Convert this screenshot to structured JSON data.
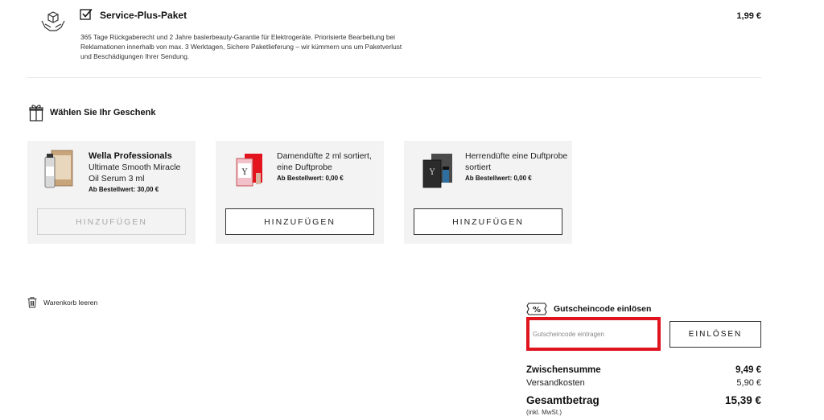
{
  "service_plus": {
    "title": "Service-Plus-Paket",
    "price": "1,99 €",
    "description": "365 Tage Rückgaberecht und 2 Jahre baslerbeauty-Garantie für Elektrogeräte. Priorisierte Bearbeitung bei Reklamationen innerhalb von max. 3 Werktagen, Sichere Paketlieferung – wir kümmern uns um Paketverlust und Beschädigungen Ihrer Sendung.",
    "icon": "box-hands-icon",
    "checked": true
  },
  "gifts": {
    "title": "Wählen Sie Ihr Geschenk",
    "icon": "gift-icon",
    "items": [
      {
        "brand": "Wella Professionals",
        "name": "Ultimate Smooth Miracle Oil Serum 3 ml",
        "min_order": "Ab Bestellwert: 30,00 €",
        "button": "HINZUFÜGEN",
        "disabled": true
      },
      {
        "brand": "",
        "name": "Damendüfte 2 ml sortiert, eine Duftprobe",
        "min_order": "Ab Bestellwert: 0,00 €",
        "button": "HINZUFÜGEN",
        "disabled": false
      },
      {
        "brand": "",
        "name": "Herrendüfte eine Duftprobe sortiert",
        "min_order": "Ab Bestellwert: 0,00 €",
        "button": "HINZUFÜGEN",
        "disabled": false
      }
    ]
  },
  "cart": {
    "clear_label": "Warenkorb leeren",
    "icon": "trash-icon"
  },
  "coupon": {
    "title": "Gutscheincode einlösen",
    "placeholder": "Gutscheincode eintragen",
    "value": "",
    "button": "EINLÖSEN",
    "icon": "percent-ticket-icon",
    "highlight_color": "#e0141e"
  },
  "summary": {
    "subtotal_label": "Zwischensumme",
    "subtotal_value": "9,49 €",
    "shipping_label": "Versandkosten",
    "shipping_value": "5,90 €",
    "total_label": "Gesamtbetrag",
    "total_value": "15,39 €",
    "vat_note": "(inkl. MwSt.)"
  }
}
